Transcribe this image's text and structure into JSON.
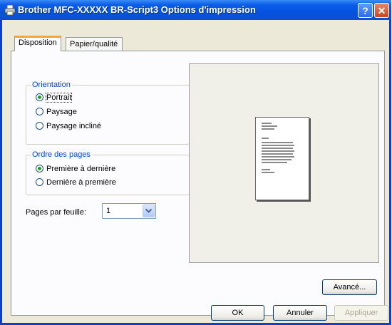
{
  "window": {
    "title": "Brother MFC-XXXXX BR-Script3 Options d'impression",
    "help_label": "?",
    "close_label": "✕"
  },
  "tabs": [
    {
      "label": "Disposition",
      "active": true
    },
    {
      "label": "Papier/qualité",
      "active": false
    }
  ],
  "orientation": {
    "legend": "Orientation",
    "options": [
      {
        "label": "Portrait",
        "checked": true
      },
      {
        "label": "Paysage",
        "checked": false
      },
      {
        "label": "Paysage incliné",
        "checked": false
      }
    ]
  },
  "page_order": {
    "legend": "Ordre des pages",
    "options": [
      {
        "label": "Première à dernière",
        "checked": true
      },
      {
        "label": "Dernière à première",
        "checked": false
      }
    ]
  },
  "pages_per_sheet": {
    "label": "Pages par feuille:",
    "value": "1"
  },
  "buttons": {
    "advanced": "Avancé...",
    "ok": "OK",
    "cancel": "Annuler",
    "apply": "Appliquer"
  },
  "colors": {
    "titlebar": "#0553e0",
    "legend_text": "#0046d5",
    "tab_highlight": "#f5a43a",
    "dialog_bg": "#ece9d8"
  }
}
